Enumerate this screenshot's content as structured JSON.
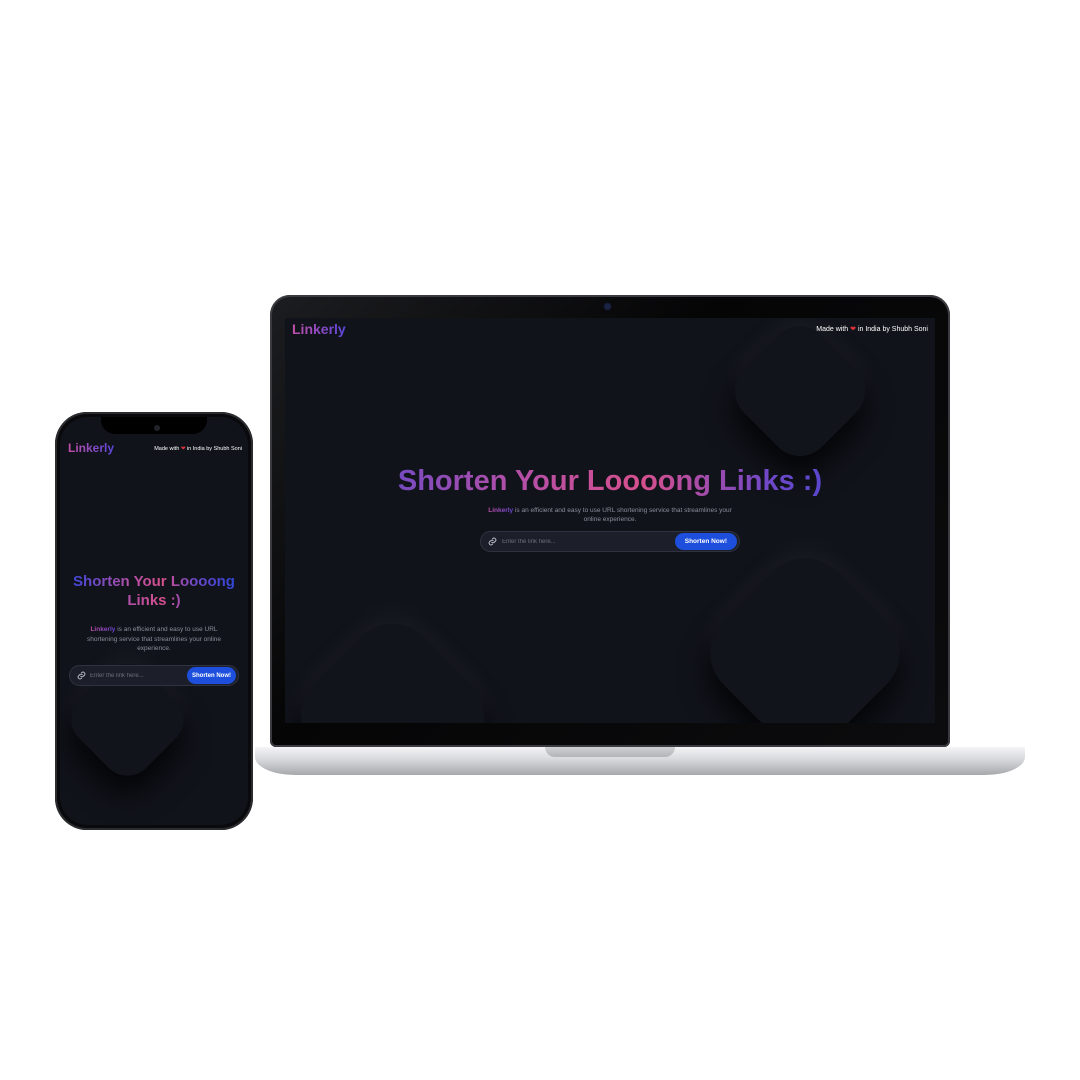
{
  "app": {
    "logo": "Linkerly",
    "credit": {
      "prefix": "Made with",
      "heart": "❤",
      "suffix": "in India by Shubh Soni"
    },
    "hero": {
      "title": "Shorten Your Loooong Links :)",
      "description_brand": "Linkerly",
      "description_rest": "is an efficient and easy to use URL shortening service that streamlines your online experience."
    },
    "form": {
      "icon": "link-icon",
      "placeholder": "Enter the link here...",
      "button_label": "Shorten Now!"
    }
  },
  "colors": {
    "background": "#11131b",
    "button": "#1d4fdc",
    "gradient_pink": "#d6508d",
    "gradient_blue": "#3f46d8",
    "heart": "#e0313b"
  }
}
